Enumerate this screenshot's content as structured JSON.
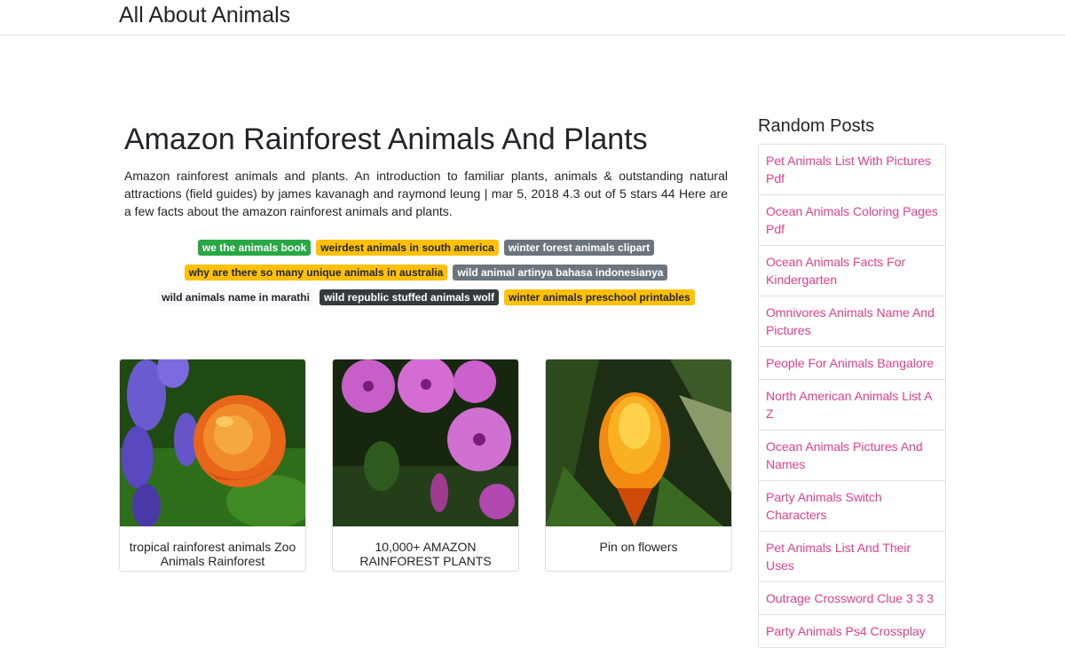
{
  "site": {
    "brand": "All About Animals"
  },
  "article": {
    "title": "Amazon Rainforest Animals And Plants",
    "description": "Amazon rainforest animals and plants. An introduction to familiar plants, animals & outstanding natural attractions (field guides) by james kavanagh and raymond leung | mar 5, 2018 4.3 out of 5 stars 44 Here are a few facts about the amazon rainforest animals and plants."
  },
  "tags": [
    {
      "label": "we the animals book",
      "style": "success"
    },
    {
      "label": "weirdest animals in south america",
      "style": "warning"
    },
    {
      "label": "winter forest animals clipart",
      "style": "secondary"
    },
    {
      "label": "why are there so many unique animals in australia",
      "style": "warning"
    },
    {
      "label": "wild animal artinya bahasa indonesianya",
      "style": "secondary"
    },
    {
      "label": "wild animals name in marathi",
      "style": "light"
    },
    {
      "label": "wild republic stuffed animals wolf",
      "style": "dark"
    },
    {
      "label": "winter animals preschool printables",
      "style": "warning"
    }
  ],
  "cards": [
    {
      "caption": "tropical rainforest animals Zoo Animals Rainforest",
      "image": "flowers-rose-foxglove"
    },
    {
      "caption": "10,000+ AMAZON RAINFOREST PLANTS",
      "image": "flowers-pink-morning-glory"
    },
    {
      "caption": "Pin on flowers",
      "image": "flower-orange-bromeliad"
    }
  ],
  "sidebar": {
    "heading": "Random Posts",
    "items": [
      "Pet Animals List With Pictures Pdf",
      "Ocean Animals Coloring Pages Pdf",
      "Ocean Animals Facts For Kindergarten",
      "Omnivores Animals Name And Pictures",
      "People For Animals Bangalore",
      "North American Animals List A Z",
      "Ocean Animals Pictures And Names",
      "Party Animals Switch Characters",
      "Pet Animals List And Their Uses",
      "Outrage Crossword Clue 3 3 3",
      "Party Animals Ps4 Crossplay"
    ]
  }
}
